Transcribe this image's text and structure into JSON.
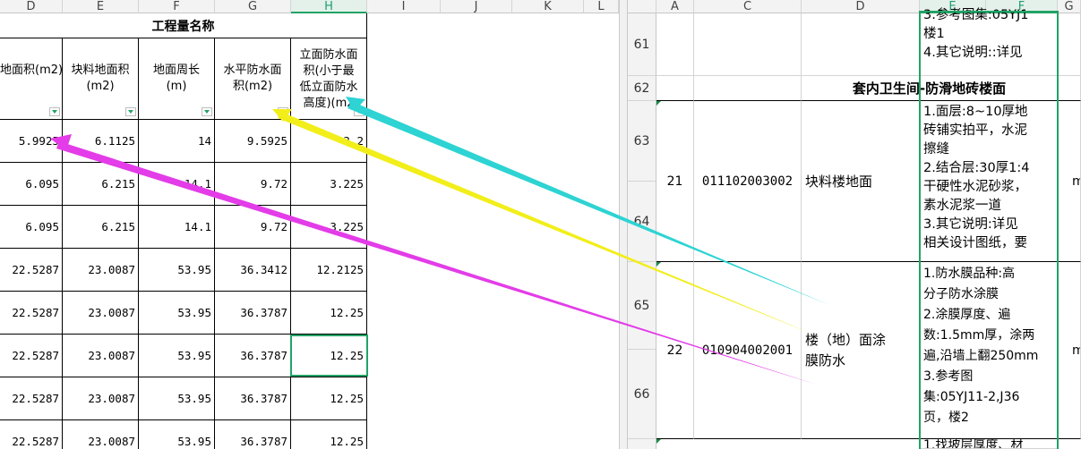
{
  "left": {
    "columns": [
      "D",
      "E",
      "F",
      "G",
      "H",
      "I",
      "J",
      "K",
      "L"
    ],
    "active_column": "H",
    "group_header": "工程量名称",
    "headers": {
      "D": "地面积(m2)",
      "E": "块料地面积\n(m2)",
      "F": "地面周长\n(m)",
      "G": "水平防水面\n积(m2)",
      "H": "立面防水面\n积(小于最\n低立面防水\n高度)(m2"
    },
    "rows": [
      [
        "5.9925",
        "6.1125",
        "14",
        "9.5925",
        "3.2"
      ],
      [
        "6.095",
        "6.215",
        "14.1",
        "9.72",
        "3.225"
      ],
      [
        "6.095",
        "6.215",
        "14.1",
        "9.72",
        "3.225"
      ],
      [
        "22.5287",
        "23.0087",
        "53.95",
        "36.3412",
        "12.2125"
      ],
      [
        "22.5287",
        "23.0087",
        "53.95",
        "36.3787",
        "12.25"
      ],
      [
        "22.5287",
        "23.0087",
        "53.95",
        "36.3787",
        "12.25"
      ],
      [
        "22.5287",
        "23.0087",
        "53.95",
        "36.3787",
        "12.25"
      ],
      [
        "22.5287",
        "23.0087",
        "53.95",
        "36.3787",
        "12.25"
      ]
    ]
  },
  "right": {
    "columns": [
      "A",
      "C",
      "D",
      "E",
      "F",
      "G"
    ],
    "active_columns": [
      "E",
      "F"
    ],
    "row_numbers": [
      "61",
      "62",
      "63",
      "64",
      "65",
      "66"
    ],
    "top_block_text": "3.参考图集:05YJ1\n楼1\n4.其它说明::详见",
    "section_title": "套内卫生间-防滑地砖楼面",
    "item21": {
      "seq": "21",
      "code": "011102003002",
      "name": "块料楼地面",
      "desc": "1.面层:8~10厚地\n砖铺实拍平，水泥\n擦缝\n2.结合层:30厚1:4\n干硬性水泥砂浆，\n素水泥浆一道\n3.其它说明:详见\n相关设计图纸，要",
      "unit": "m"
    },
    "item22": {
      "seq": "22",
      "code": "010904002001",
      "name": "楼（地）面涂\n膜防水",
      "desc": "1.防水膜品种:高\n分子防水涂膜\n2.涂膜厚度、遍\n数:1.5mm厚，涂两\n遍,沿墙上翻250mm\n3.参考图\n集:05YJ11-2,J36\n页，楼2",
      "unit": "m"
    },
    "bottom_text": "1.找坡层厚度、材"
  },
  "annotations": {
    "colors": {
      "cyan": "#2ed3d3",
      "yellow": "#f2ee1a",
      "magenta": "#e33ce8"
    }
  }
}
